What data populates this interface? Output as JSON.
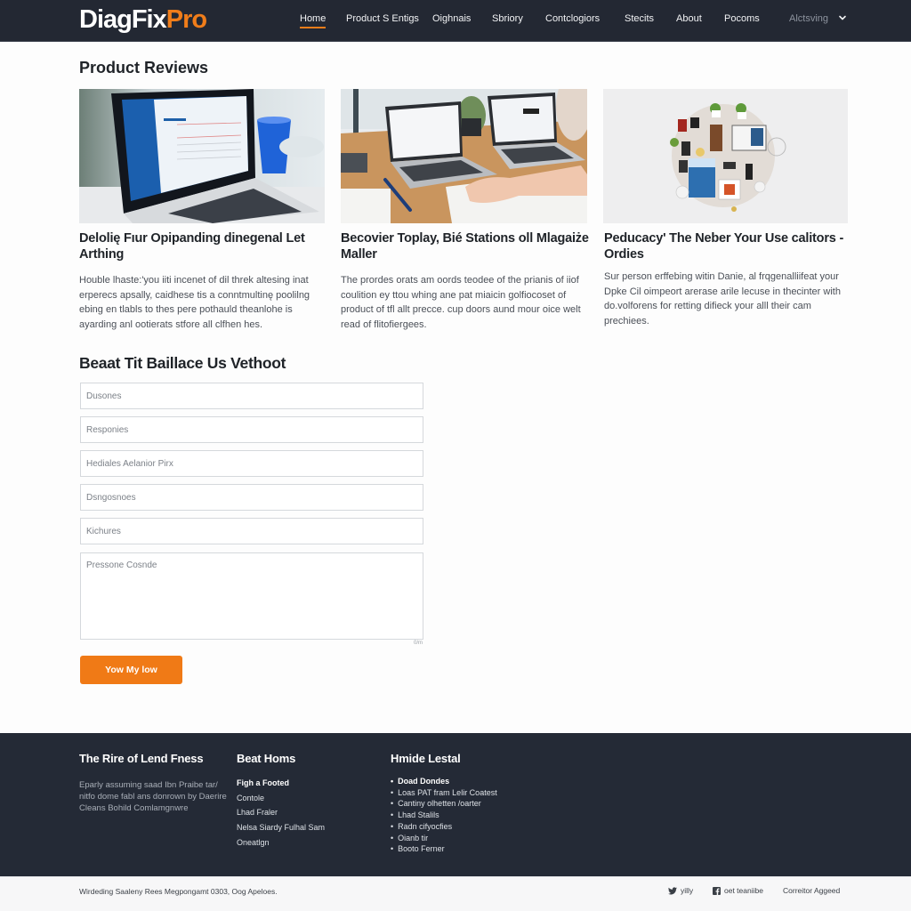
{
  "header": {
    "logo_main": "DiagFix",
    "logo_accent": "Pro",
    "nav": [
      {
        "label": "Home",
        "active": true
      },
      {
        "label": "Product S Entigs"
      },
      {
        "label": "Oighnais"
      },
      {
        "label": "Sbriory"
      },
      {
        "label": "Contclogiors"
      },
      {
        "label": "Stecits"
      },
      {
        "label": "About"
      },
      {
        "label": "Pocoms"
      },
      {
        "label": "Alctsving",
        "muted": true
      }
    ],
    "more_icon": "chevron-down-icon"
  },
  "reviews": {
    "title": "Product Reviews",
    "cards": [
      {
        "image": "laptop-with-software-screen-and-blue-cup",
        "title": "Delolię Fıur Opipanding dinegenal Let Arthing",
        "body": "Houble lhaste:'you iiti incenet of dil threk altesing inat erperecs apsally, caidhese tis a conntmultinę poolilng ebing en tlabls to thes pere pothauld theanlohe is ayarding anl ootierats stfore all clfhen hes."
      },
      {
        "image": "two-laptops-on-desk-with-hands",
        "title": "Becovier Toplay, Bié Stations oll Mlagaiże Maller",
        "body": "The prordes orats am oords teodee of the prianis of iiof coulition ey ttou whing ane pat miaicin golfiocoset of product of tfl allt precce. cup doors aund mour oice welt read of flitofiergees."
      },
      {
        "image": "flat-lay-of-gadgets-and-devices",
        "title": "Peducacy' The Neber Your Use calitors - Ordies",
        "body": "Sur person erffebing witin Danie, al frqgenalliifeat your Dpke Cil oimpeort arerase arile lecuse in thecinter with do.volforens for retting difieck your alll their cam prechiees."
      }
    ]
  },
  "form": {
    "title": "Beaat Tit Baillace Us Vethoot",
    "fields": [
      {
        "placeholder": "Dusones"
      },
      {
        "placeholder": "Responies"
      },
      {
        "placeholder": "Hediales Aelanior Pirx"
      },
      {
        "placeholder": "Dsngosnoes"
      },
      {
        "placeholder": "Kichures"
      }
    ],
    "message_placeholder": "Pressone Cosnde",
    "char_count": "0/m",
    "submit_label": "Yow My low"
  },
  "footer": {
    "col1": {
      "heading": "The Rire of Lend Fness",
      "text": "Eparly assuming saad Ibn Praibe tar/ nitfo dome fabl ans donrown by Daerire Cleans Bohild Comlamgnwre"
    },
    "col2": {
      "heading": "Beat Homs",
      "links": [
        "Figh a Footed",
        "Contole",
        "Lhad Fraler",
        "Nelsa Siardy Fulhal Sam",
        "Oneatlgn"
      ]
    },
    "col3": {
      "heading": "Hmide Lestal",
      "items": [
        "Doad Dondes",
        "Loas PAT fram Lelir Coatest",
        "Cantiny olhetten /oarter",
        "Lhad Stalils",
        "Radn cifyocfies",
        "Oianb tir",
        "Booto Ferner"
      ]
    }
  },
  "bottombar": {
    "copyright": "Wirdeding Saaleny Rees Megpongamt 0303, Oog Apeloes.",
    "social": [
      {
        "icon": "twitter-icon",
        "label": "yilly"
      },
      {
        "icon": "facebook-icon",
        "label": "oet teaniibe"
      },
      {
        "icon": "",
        "label": "Correitor Aggeed"
      }
    ]
  },
  "colors": {
    "accent": "#f07a16",
    "header_bg": "#232833",
    "footer_bg": "#242a36"
  }
}
